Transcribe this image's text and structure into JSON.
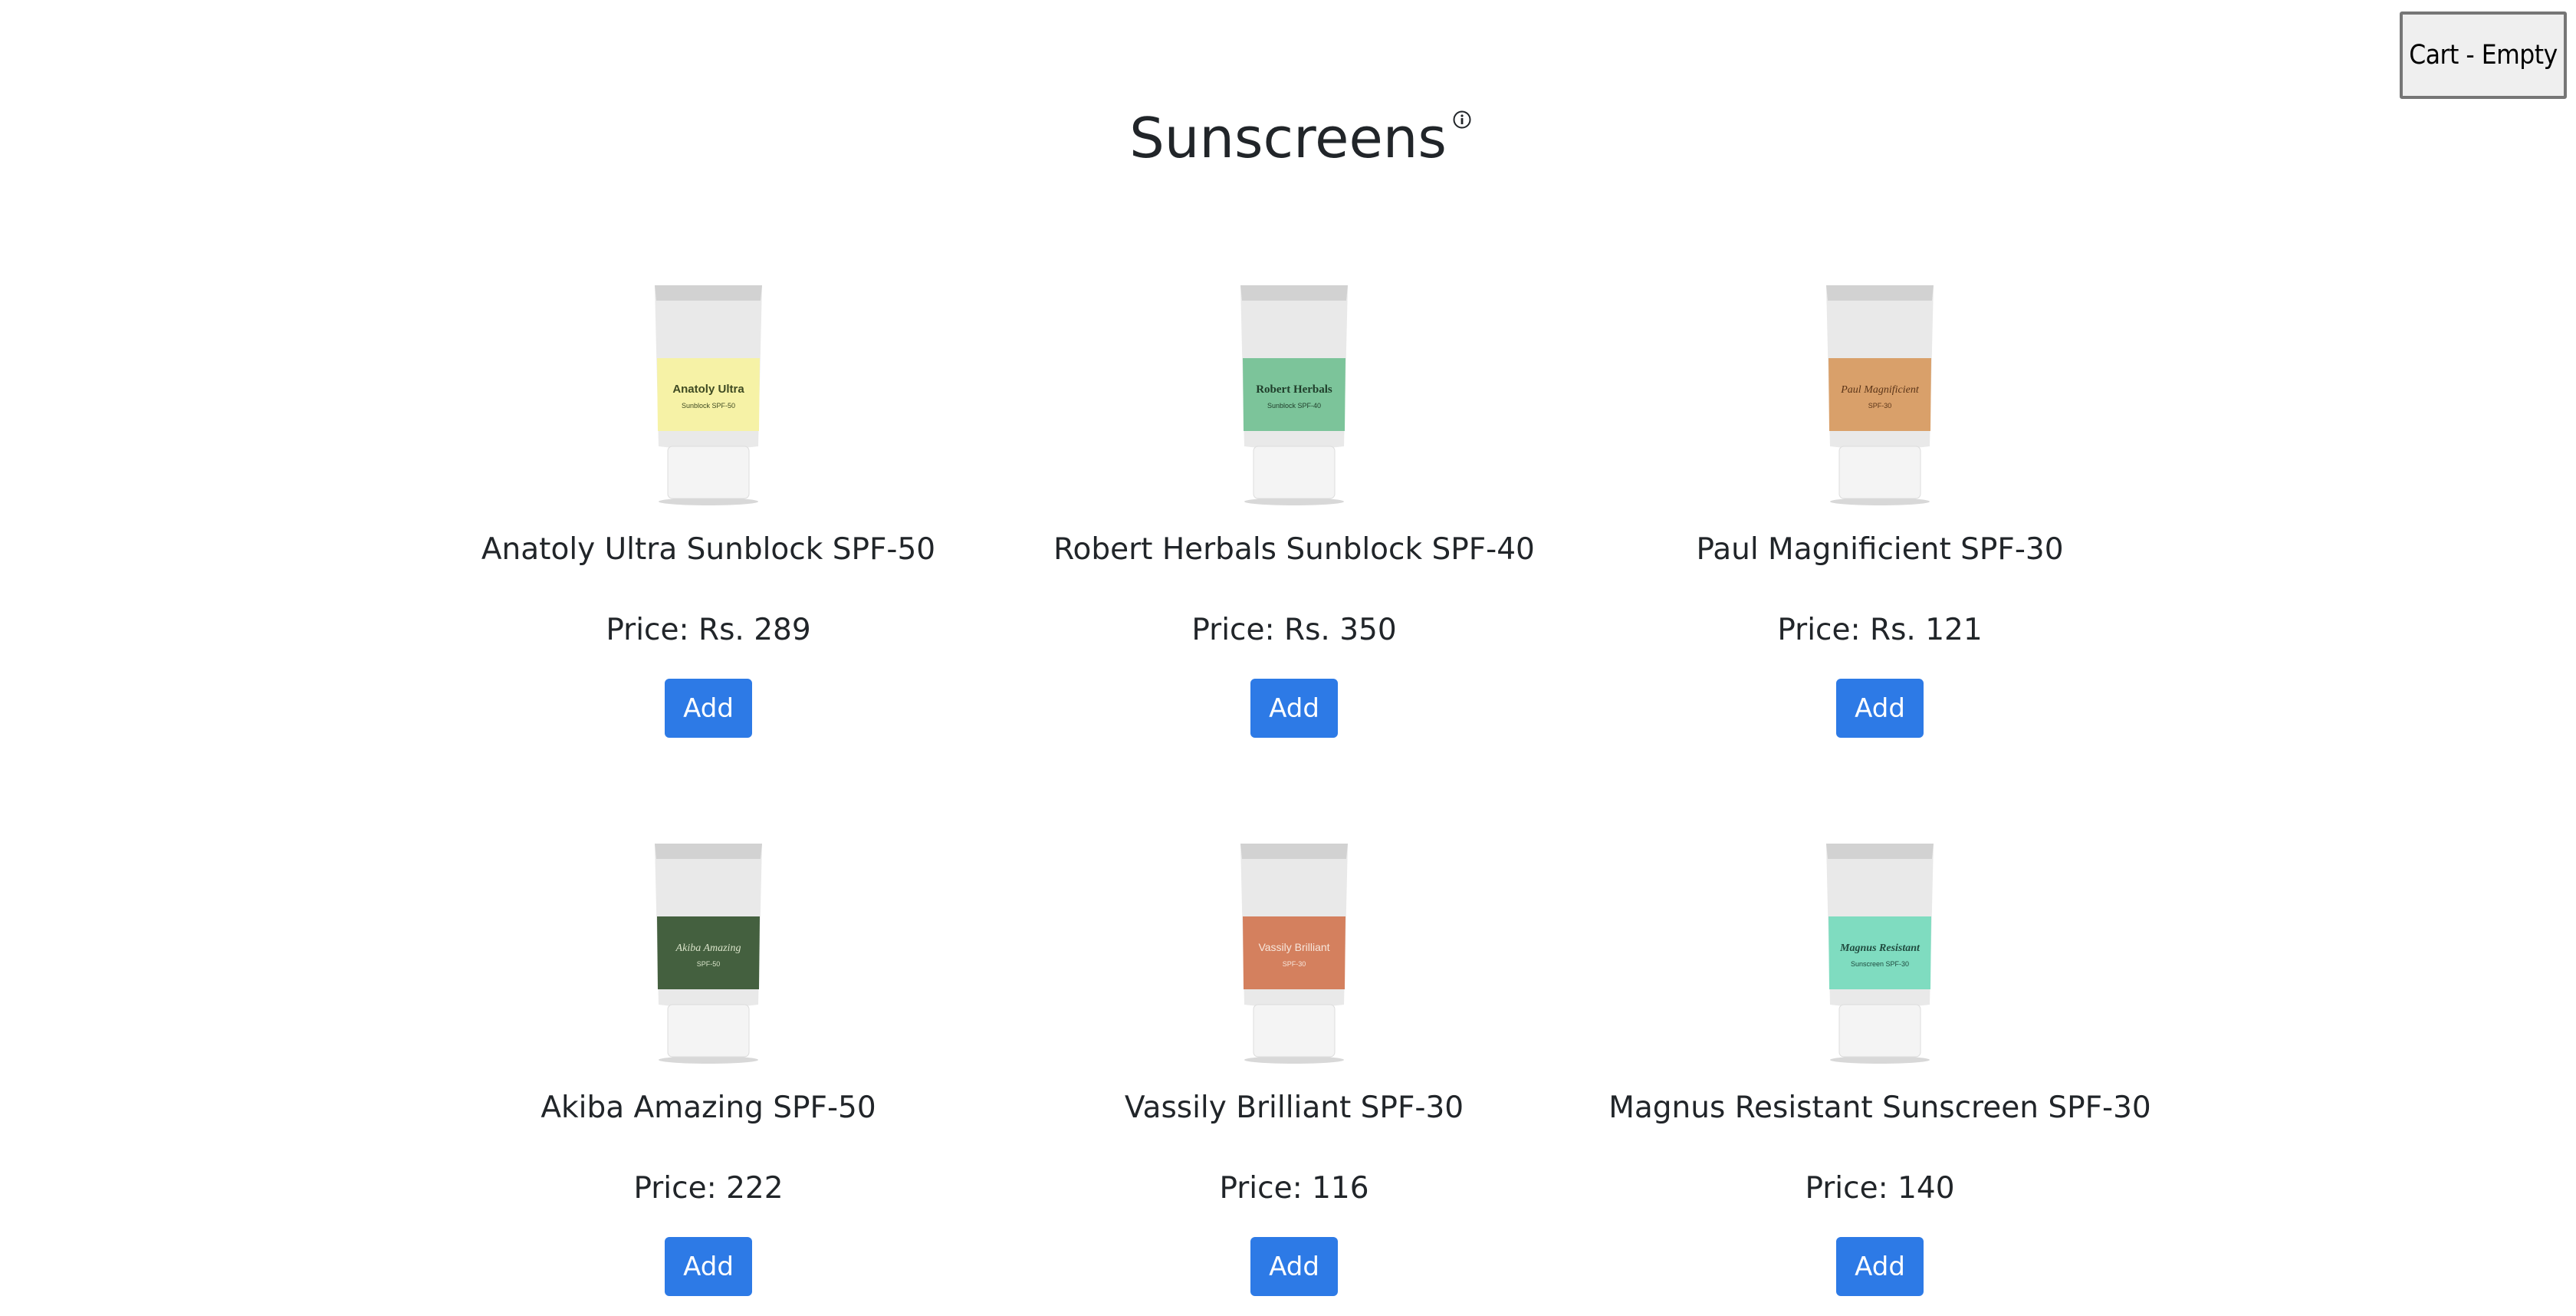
{
  "header": {
    "title": "Sunscreens",
    "info_icon": "info-circle-icon",
    "cart_label": "Cart - Empty"
  },
  "accent_color": "#2d7ae6",
  "products": [
    {
      "name": "Anatoly Ultra Sunblock SPF-50",
      "price": "Price: Rs. 289",
      "add_label": "Add",
      "label_color": "#f6f2a6",
      "label_text_color": "#3e4a22",
      "tube_brand": "Anatoly Ultra",
      "tube_sub": "Sunblock SPF-50"
    },
    {
      "name": "Robert Herbals Sunblock SPF-40",
      "price": "Price: Rs. 350",
      "add_label": "Add",
      "label_color": "#7cc49a",
      "label_text_color": "#1f3d2a",
      "tube_brand": "Robert Herbals",
      "tube_sub": "Sunblock SPF-40"
    },
    {
      "name": "Paul Magnificient SPF-30",
      "price": "Price: Rs. 121",
      "add_label": "Add",
      "label_color": "#d9a06a",
      "label_text_color": "#5a3418",
      "tube_brand": "Paul Magnificient",
      "tube_sub": "SPF-30"
    },
    {
      "name": "Akiba Amazing SPF-50",
      "price": "Price: 222",
      "add_label": "Add",
      "label_color": "#44603f",
      "label_text_color": "#d9e3c9",
      "tube_brand": "Akiba Amazing",
      "tube_sub": "SPF-50"
    },
    {
      "name": "Vassily Brilliant SPF-30",
      "price": "Price: 116",
      "add_label": "Add",
      "label_color": "#d4805e",
      "label_text_color": "#f7e6dc",
      "tube_brand": "Vassily Brilliant",
      "tube_sub": "SPF-30"
    },
    {
      "name": "Magnus Resistant Sunscreen SPF-30",
      "price": "Price: 140",
      "add_label": "Add",
      "label_color": "#7fdcc0",
      "label_text_color": "#1f4a3e",
      "tube_brand": "Magnus Resistant",
      "tube_sub": "Sunscreen SPF-30"
    }
  ]
}
